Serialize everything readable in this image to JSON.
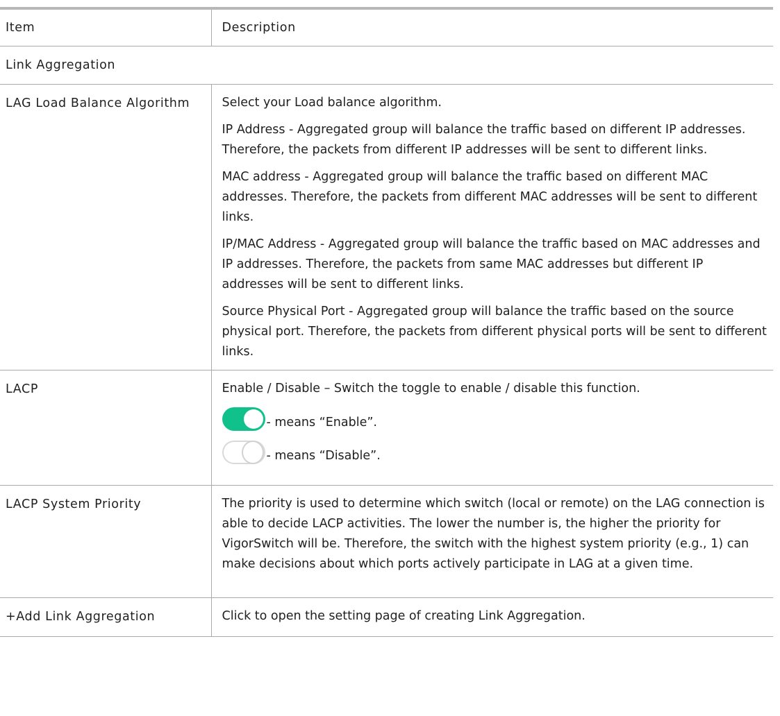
{
  "header": {
    "item": "Item",
    "description": "Description"
  },
  "section_title": "Link Aggregation",
  "rows": {
    "lag": {
      "label": "LAG Load Balance Algorithm",
      "paragraphs": [
        "Select your Load balance algorithm.",
        "IP Address - Aggregated group will balance the traffic based on different IP addresses. Therefore, the packets from different IP addresses will be sent to different links.",
        "MAC address - Aggregated group will balance the traffic based on different MAC addresses. Therefore, the packets from different MAC addresses will be sent to different links.",
        "IP/MAC Address - Aggregated group will balance the traffic based on MAC addresses and IP addresses. Therefore, the packets from same MAC addresses but different IP addresses will be sent to different links.",
        "Source Physical Port - Aggregated group will balance the traffic based on the source physical port. Therefore, the packets from different physical ports will be sent to different links."
      ]
    },
    "lacp": {
      "label": "LACP",
      "text": "Enable / Disable – Switch the toggle to enable / disable this function.",
      "enable_text": "- means “Enable”.",
      "disable_text": "- means “Disable”.",
      "toggle_on_color": "#10c18b"
    },
    "priority": {
      "label": "LACP System Priority",
      "text": "The priority is used to determine which switch (local or remote) on the LAG connection is able to decide LACP activities. The lower the number is, the higher the priority for VigorSwitch will be. Therefore, the switch with the highest system priority (e.g., 1) can make decisions about which ports actively participate in LAG at a given time."
    },
    "add": {
      "label": "+Add Link Aggregation",
      "text": "Click to open the setting page of creating Link Aggregation."
    }
  }
}
